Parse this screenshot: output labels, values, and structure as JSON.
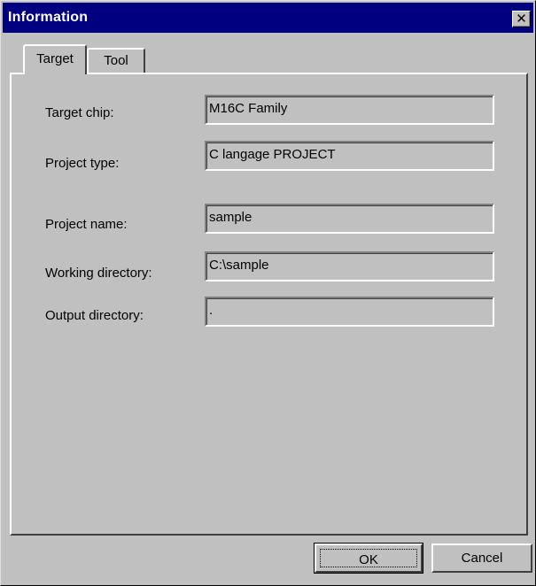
{
  "window": {
    "title": "Information",
    "close_glyph": "✕"
  },
  "tabs": [
    {
      "label": "Target",
      "selected": true
    },
    {
      "label": "Tool",
      "selected": false
    }
  ],
  "target": {
    "target_chip": {
      "label": "Target chip:",
      "value": "M16C Family"
    },
    "project_type": {
      "label": "Project type:",
      "value": "C langage PROJECT"
    },
    "project_name": {
      "label": "Project name:",
      "value": "sample"
    },
    "working_directory": {
      "label": "Working directory:",
      "value": "C:\\sample"
    },
    "output_directory": {
      "label": "Output directory:",
      "value": "."
    }
  },
  "buttons": {
    "ok": "OK",
    "cancel": "Cancel"
  },
  "colors": {
    "titlebar": "#000080",
    "face": "#c0c0c0"
  }
}
